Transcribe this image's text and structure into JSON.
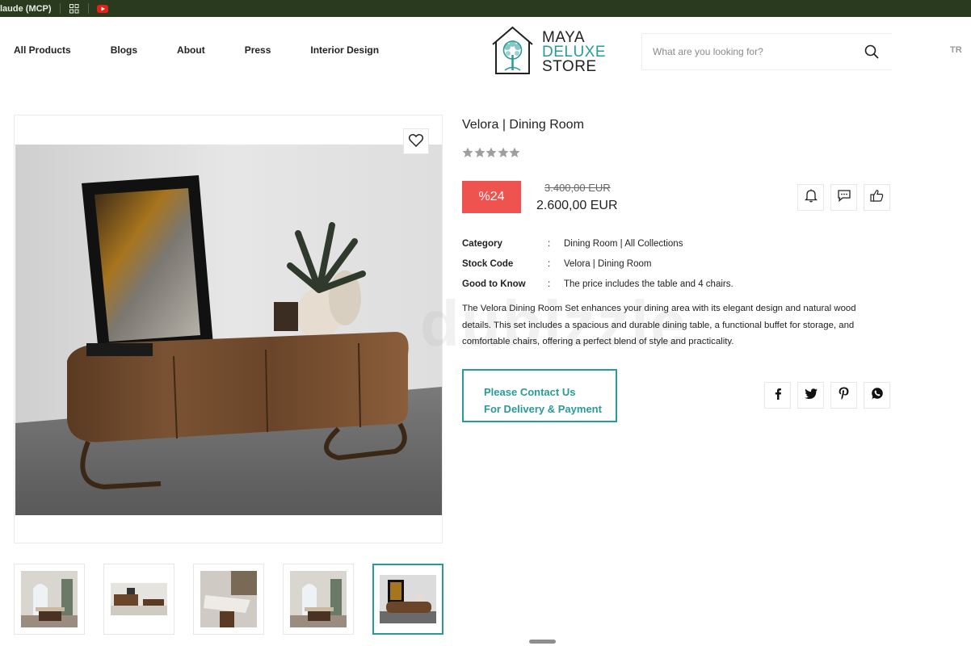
{
  "browser": {
    "bookmarks": [
      {
        "label": "laude (MCP)"
      },
      {
        "icon": "apps-grid-icon"
      },
      {
        "icon": "youtube-icon"
      }
    ]
  },
  "header": {
    "nav": [
      "All Products",
      "Blogs",
      "About",
      "Press",
      "Interior Design"
    ],
    "logo": {
      "line1": "MAYA",
      "line2": "DELUXE",
      "line3": "STORE",
      "icon": "house-tree-icon"
    },
    "search": {
      "placeholder": "What are you looking for?"
    },
    "language": "TR"
  },
  "product": {
    "title": "Velora | Dining Room",
    "rating": {
      "value": 0,
      "max": 5
    },
    "discount_label": "%24",
    "old_price": "3.400,00 EUR",
    "new_price": "2.600,00 EUR",
    "specs": [
      {
        "label": "Category",
        "colon": ":",
        "value": "Dining Room | All Collections"
      },
      {
        "label": "Stock Code",
        "colon": ":",
        "value": "Velora | Dining Room"
      },
      {
        "label": "Good to Know",
        "colon": ":",
        "value": "The price includes the table and 4 chairs."
      }
    ],
    "description": "The Velora Dining Room Set enhances your dining area with its elegant design and natural wood details. This set includes a spacious and durable dining table, a functional buffet for storage, and comfortable chairs, offering a perfect blend of style and practicality.",
    "contact_button": {
      "line1": "Please Contact Us",
      "line2": "For Delivery & Payment"
    },
    "watermark": "dubizzle"
  },
  "actions": [
    "bell-icon",
    "comment-icon",
    "thumbs-up-icon"
  ],
  "share": [
    "facebook-icon",
    "twitter-icon",
    "pinterest-icon",
    "whatsapp-icon"
  ],
  "gallery": {
    "thumbnails": [
      "dining-room-arch-window",
      "buffet-wide",
      "dining-table-closeup",
      "dining-room-arch-window-2",
      "buffet-with-frame"
    ],
    "active_index": 4
  },
  "colors": {
    "accent": "#2a9a97",
    "discount": "#ef5350",
    "topbar": "#2a3a1f"
  }
}
